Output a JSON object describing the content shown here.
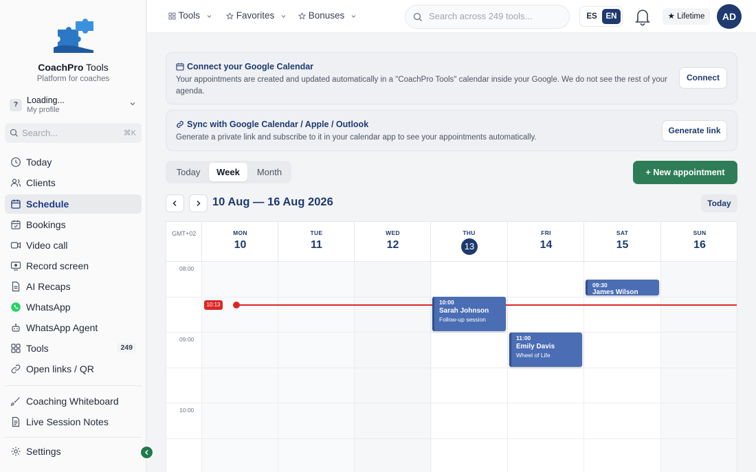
{
  "brand": {
    "name_bold": "CoachPro",
    "name_rest": "Tools",
    "subtitle": "Platform for coaches"
  },
  "profile": {
    "initial": "?",
    "name": "Loading...",
    "sub": "My profile"
  },
  "sidebar_search": {
    "placeholder": "Search...",
    "shortcut": "⌘K"
  },
  "sidebar": {
    "items": [
      {
        "label": "Today",
        "icon": "clock-icon"
      },
      {
        "label": "Clients",
        "icon": "users-icon"
      },
      {
        "label": "Schedule",
        "icon": "calendar-icon",
        "active": true
      },
      {
        "label": "Bookings",
        "icon": "calendar-check-icon"
      },
      {
        "label": "Video call",
        "icon": "video-icon"
      },
      {
        "label": "Record screen",
        "icon": "record-screen-icon"
      },
      {
        "label": "AI Recaps",
        "icon": "document-icon"
      },
      {
        "label": "WhatsApp",
        "icon": "whatsapp-icon"
      },
      {
        "label": "WhatsApp Agent",
        "icon": "robot-icon"
      },
      {
        "label": "Tools",
        "icon": "grid-icon",
        "badge": "249"
      },
      {
        "label": "Open links / QR",
        "icon": "link-icon"
      },
      {
        "label": "Coaching Whiteboard",
        "icon": "brush-icon"
      },
      {
        "label": "Live Session Notes",
        "icon": "notes-icon"
      },
      {
        "label": "Settings",
        "icon": "gear-icon"
      }
    ]
  },
  "topbar": {
    "menus": [
      {
        "label": "Tools",
        "icon": "grid-icon"
      },
      {
        "label": "Favorites",
        "icon": "star-icon"
      },
      {
        "label": "Bonuses",
        "icon": "star-icon"
      }
    ],
    "search_placeholder": "Search across 249 tools...",
    "lang_es": "ES",
    "lang_en": "EN",
    "lifetime": "★ Lifetime",
    "avatar": "AD"
  },
  "google_card": {
    "title": "Connect your Google Calendar",
    "desc": "Your appointments are created and updated automatically in a \"CoachPro Tools\" calendar inside your Google. We do not see the rest of your agenda.",
    "button": "Connect"
  },
  "sync_card": {
    "title": "Sync with Google Calendar / Apple / Outlook",
    "desc": "Generate a private link and subscribe to it in your calendar app to see your appointments automatically.",
    "button": "Generate link"
  },
  "view_tabs": {
    "today": "Today",
    "week": "Week",
    "month": "Month",
    "selected": "Week"
  },
  "new_appointment": "New appointment",
  "calendar": {
    "range": "10 Aug — 16 Aug 2026",
    "today_button": "Today",
    "timezone": "GMT+02",
    "days": [
      {
        "name": "MON",
        "num": "10"
      },
      {
        "name": "TUE",
        "num": "11"
      },
      {
        "name": "WED",
        "num": "12"
      },
      {
        "name": "THU",
        "num": "13",
        "current": true
      },
      {
        "name": "FRI",
        "num": "14"
      },
      {
        "name": "SAT",
        "num": "15"
      },
      {
        "name": "SUN",
        "num": "16"
      }
    ],
    "hours": [
      "08:00",
      "09:00",
      "10:00"
    ],
    "now": "10:13",
    "events": [
      {
        "time": "09:30",
        "name": "James Wilson",
        "desc": "",
        "day": 5
      },
      {
        "time": "10:00",
        "name": "Sarah Johnson",
        "desc": "Follow-up session",
        "day": 3
      },
      {
        "time": "11:00",
        "name": "Emily Davis",
        "desc": "Wheel of Life",
        "day": 4
      }
    ]
  },
  "colors": {
    "primary": "#1e3a6e",
    "accent_green": "#2e7d57",
    "now_line": "#dc2626",
    "event": "#4a6db4"
  }
}
